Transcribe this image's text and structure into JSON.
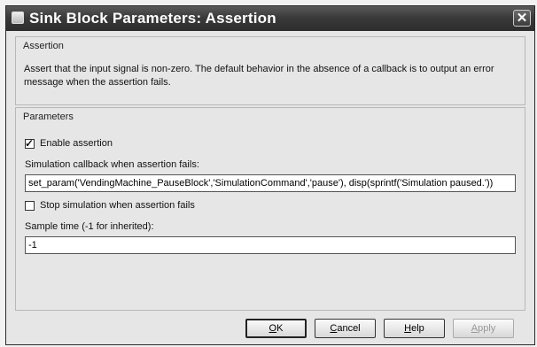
{
  "window": {
    "title": "Sink Block Parameters: Assertion"
  },
  "assertion_group": {
    "title": "Assertion",
    "description": "Assert that the input signal is non-zero.  The default behavior in the absence of a callback is to output an error message when the assertion fails."
  },
  "parameters_group": {
    "title": "Parameters",
    "enable_assertion": {
      "label": "Enable assertion",
      "checked": true
    },
    "callback_label": "Simulation callback when assertion fails:",
    "callback_value": "set_param('VendingMachine_PauseBlock','SimulationCommand','pause'), disp(sprintf('Simulation paused.'))",
    "stop_simulation": {
      "label": "Stop simulation when assertion fails",
      "checked": false
    },
    "sample_time_label": "Sample time (-1 for inherited):",
    "sample_time_value": "-1"
  },
  "buttons": {
    "ok": {
      "accel": "O",
      "rest": "K"
    },
    "cancel": {
      "accel": "C",
      "rest": "ancel"
    },
    "help": {
      "accel": "H",
      "rest": "elp"
    },
    "apply": {
      "accel": "A",
      "rest": "pply"
    }
  }
}
